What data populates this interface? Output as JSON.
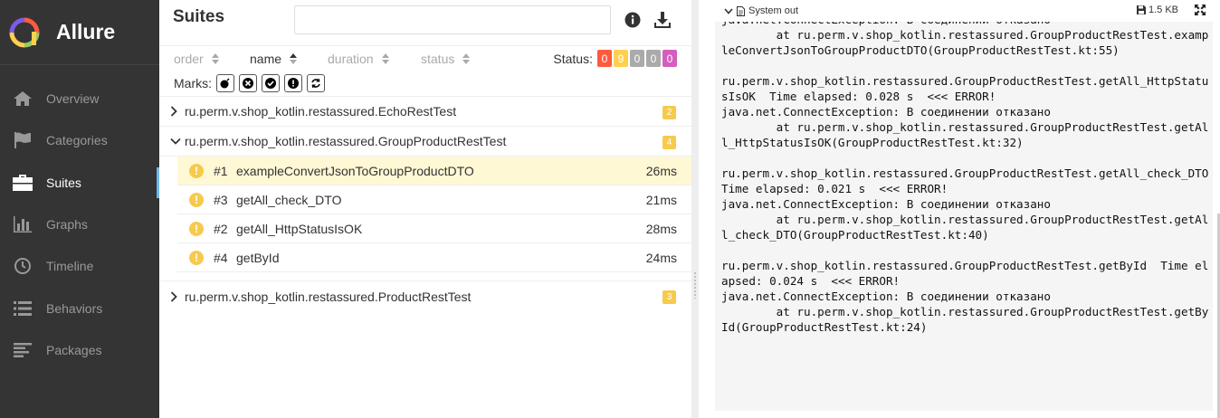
{
  "app": {
    "name": "Allure"
  },
  "sidebar": {
    "items": [
      {
        "label": "Overview",
        "icon": "home-icon",
        "active": false
      },
      {
        "label": "Categories",
        "icon": "flag-icon",
        "active": false
      },
      {
        "label": "Suites",
        "icon": "briefcase-icon",
        "active": true
      },
      {
        "label": "Graphs",
        "icon": "bar-chart-icon",
        "active": false
      },
      {
        "label": "Timeline",
        "icon": "clock-icon",
        "active": false
      },
      {
        "label": "Behaviors",
        "icon": "list-icon",
        "active": false
      },
      {
        "label": "Packages",
        "icon": "align-left-icon",
        "active": false
      }
    ]
  },
  "suites": {
    "title": "Suites",
    "search": {
      "value": "",
      "placeholder": ""
    },
    "sort": {
      "order": "order",
      "name": "name",
      "duration": "duration",
      "status": "status",
      "active": "name"
    },
    "status_label": "Status:",
    "status_badges": [
      {
        "count": "0",
        "color": "#fd5a3e"
      },
      {
        "count": "9",
        "color": "#ffd050"
      },
      {
        "count": "0",
        "color": "#97cc64"
      },
      {
        "count": "0",
        "color": "#aaaaaa"
      },
      {
        "count": "0",
        "color": "#d35ebe"
      }
    ],
    "marks_label": "Marks:",
    "marks": [
      "flaky-icon",
      "new-failed-icon",
      "new-passed-icon",
      "new-broken-icon",
      "retries-icon"
    ],
    "groups": [
      {
        "name": "ru.perm.v.shop_kotlin.restassured.EchoRestTest",
        "count": "2",
        "expanded": false
      },
      {
        "name": "ru.perm.v.shop_kotlin.restassured.GroupProductRestTest",
        "count": "4",
        "expanded": true,
        "tests": [
          {
            "num": "#1",
            "name": "exampleConvertJsonToGroupProductDTO",
            "duration": "26ms",
            "selected": true
          },
          {
            "num": "#3",
            "name": "getAll_check_DTO",
            "duration": "21ms",
            "selected": false
          },
          {
            "num": "#2",
            "name": "getAll_HttpStatusIsOK",
            "duration": "28ms",
            "selected": false
          },
          {
            "num": "#4",
            "name": "getById",
            "duration": "24ms",
            "selected": false
          }
        ]
      },
      {
        "name": "ru.perm.v.shop_kotlin.restassured.ProductRestTest",
        "count": "3",
        "expanded": false
      }
    ]
  },
  "system_out": {
    "title": "System out",
    "size": "1.5 KB",
    "content": "java.net.ConnectException: В соединении отказано\n        at ru.perm.v.shop_kotlin.restassured.GroupProductRestTest.exampleConvertJsonToGroupProductDTO(GroupProductRestTest.kt:55)\n\nru.perm.v.shop_kotlin.restassured.GroupProductRestTest.getAll_HttpStatusIsOK  Time elapsed: 0.028 s  <<< ERROR!\njava.net.ConnectException: В соединении отказано\n        at ru.perm.v.shop_kotlin.restassured.GroupProductRestTest.getAll_HttpStatusIsOK(GroupProductRestTest.kt:32)\n\nru.perm.v.shop_kotlin.restassured.GroupProductRestTest.getAll_check_DTO  Time elapsed: 0.021 s  <<< ERROR!\njava.net.ConnectException: В соединении отказано\n        at ru.perm.v.shop_kotlin.restassured.GroupProductRestTest.getAll_check_DTO(GroupProductRestTest.kt:40)\n\nru.perm.v.shop_kotlin.restassured.GroupProductRestTest.getById  Time elapsed: 0.024 s  <<< ERROR!\njava.net.ConnectException: В соединении отказано\n        at ru.perm.v.shop_kotlin.restassured.GroupProductRestTest.getById(GroupProductRestTest.kt:24)"
  }
}
